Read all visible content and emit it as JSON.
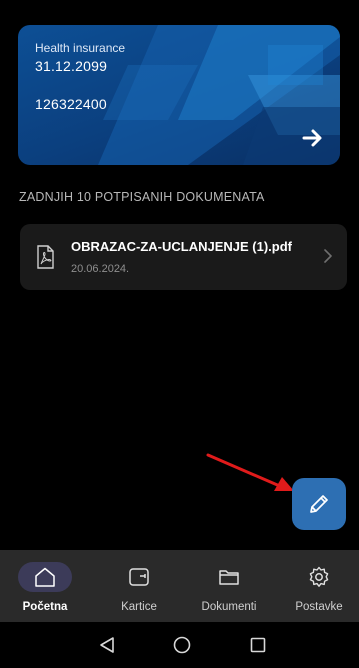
{
  "card": {
    "title": "Health insurance",
    "date": "31.12.2099",
    "number": "126322400",
    "arrow_icon": "arrow-right-icon"
  },
  "section": {
    "title": "ZADNJIH 10 POTPISANIH DOKUMENATA"
  },
  "documents": [
    {
      "name": "OBRAZAC-ZA-UCLANJENJE (1).pdf",
      "date": "20.06.2024.",
      "icon": "pdf-icon"
    }
  ],
  "fab": {
    "icon": "pencil-icon",
    "color": "#2d6fb3"
  },
  "annotation": {
    "color": "#e01b1b"
  },
  "bottom_nav": {
    "items": [
      {
        "label": "Početna",
        "icon": "home-icon",
        "active": true
      },
      {
        "label": "Kartice",
        "icon": "wallet-icon",
        "active": false
      },
      {
        "label": "Dokumenti",
        "icon": "folder-icon",
        "active": false
      },
      {
        "label": "Postavke",
        "icon": "gear-icon",
        "active": false
      }
    ]
  },
  "system_nav": {
    "back_icon": "back-triangle-icon",
    "home_icon": "home-circle-icon",
    "recents_icon": "recents-square-icon"
  }
}
